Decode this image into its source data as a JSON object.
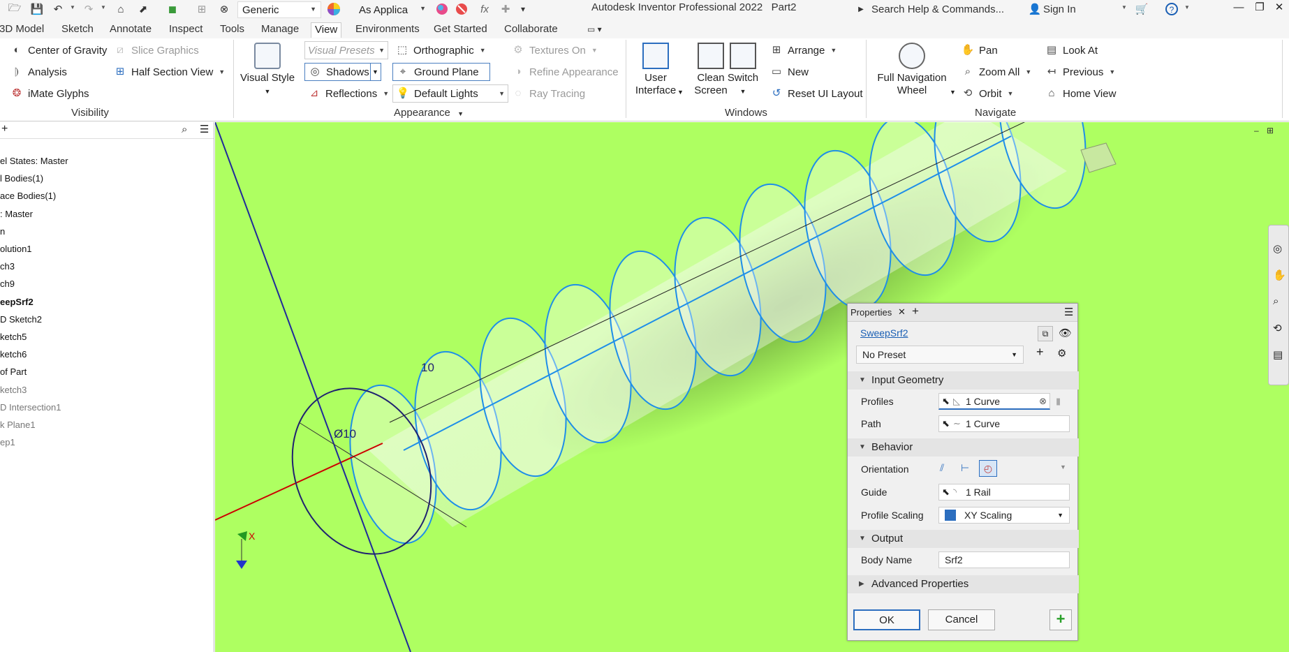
{
  "titlebar": {
    "appearance_combo": "Generic",
    "material_combo": "As Applica",
    "app_title": "Autodesk Inventor Professional 2022",
    "doc_name": "Part2",
    "search_placeholder": "Search Help & Commands...",
    "sign_in": "Sign In"
  },
  "menu": {
    "tabs": [
      "3D Model",
      "Sketch",
      "Annotate",
      "Inspect",
      "Tools",
      "Manage",
      "View",
      "Environments",
      "Get Started",
      "Collaborate"
    ],
    "active_tab": "View"
  },
  "ribbon": {
    "visibility": {
      "label": "Visibility",
      "items": [
        "Center of Gravity",
        "Slice Graphics",
        "Analysis",
        "Half Section View",
        "iMate Glyphs"
      ]
    },
    "appearance": {
      "label": "Appearance",
      "visual_style": "Visual Style",
      "visual_presets": "Visual Presets",
      "orthographic": "Orthographic",
      "textures_on": "Textures On",
      "shadows": "Shadows",
      "ground_plane": "Ground Plane",
      "refine_appearance": "Refine Appearance",
      "reflections": "Reflections",
      "default_lights": "Default Lights",
      "ray_tracing": "Ray Tracing"
    },
    "windows": {
      "label": "Windows",
      "user_interface_1": "User",
      "user_interface_2": "Interface",
      "clean_screen_1": "Clean",
      "clean_screen_2": "Screen",
      "switch": "Switch",
      "arrange": "Arrange",
      "new": "New",
      "reset_ui": "Reset UI Layout"
    },
    "navigate": {
      "label": "Navigate",
      "full_nav_1": "Full Navigation",
      "full_nav_2": "Wheel",
      "pan": "Pan",
      "zoom_all": "Zoom All",
      "orbit": "Orbit",
      "look_at": "Look At",
      "previous": "Previous",
      "home_view": "Home View"
    }
  },
  "browser": {
    "items": [
      {
        "label": "el States: Master",
        "style": "normal"
      },
      {
        "label": "l Bodies(1)",
        "style": "normal"
      },
      {
        "label": "ace Bodies(1)",
        "style": "normal"
      },
      {
        "label": ": Master",
        "style": "normal"
      },
      {
        "label": "n",
        "style": "normal"
      },
      {
        "label": "olution1",
        "style": "normal"
      },
      {
        "label": "ch3",
        "style": "normal"
      },
      {
        "label": "ch9",
        "style": "normal"
      },
      {
        "label": "eepSrf2",
        "style": "bold"
      },
      {
        "label": "D Sketch2",
        "style": "normal"
      },
      {
        "label": "ketch5",
        "style": "normal"
      },
      {
        "label": "ketch6",
        "style": "normal"
      },
      {
        "label": "of Part",
        "style": "normal"
      },
      {
        "label": "ketch3",
        "style": "dim"
      },
      {
        "label": "D Intersection1",
        "style": "dim"
      },
      {
        "label": "k Plane1",
        "style": "dim"
      },
      {
        "label": "ep1",
        "style": "dim"
      }
    ]
  },
  "viewport": {
    "dim_length": "10",
    "dim_diameter": "Ø10",
    "triad_x": "X"
  },
  "properties": {
    "tab_title": "Properties",
    "feature_name": "SweepSrf2",
    "preset": "No Preset",
    "input_geometry": "Input Geometry",
    "profiles_label": "Profiles",
    "profiles_value": "1 Curve",
    "path_label": "Path",
    "path_value": "1 Curve",
    "behavior": "Behavior",
    "orientation_label": "Orientation",
    "guide_label": "Guide",
    "guide_value": "1 Rail",
    "profile_scaling_label": "Profile Scaling",
    "profile_scaling_value": "XY Scaling",
    "output": "Output",
    "body_name_label": "Body Name",
    "body_name_value": "Srf2",
    "advanced": "Advanced Properties",
    "ok": "OK",
    "cancel": "Cancel"
  },
  "colors": {
    "viewport_bg": "#aeff61",
    "helix_blue": "#1e8ee8",
    "axis_red": "#cc0000",
    "accent_link": "#1a5fb4"
  }
}
